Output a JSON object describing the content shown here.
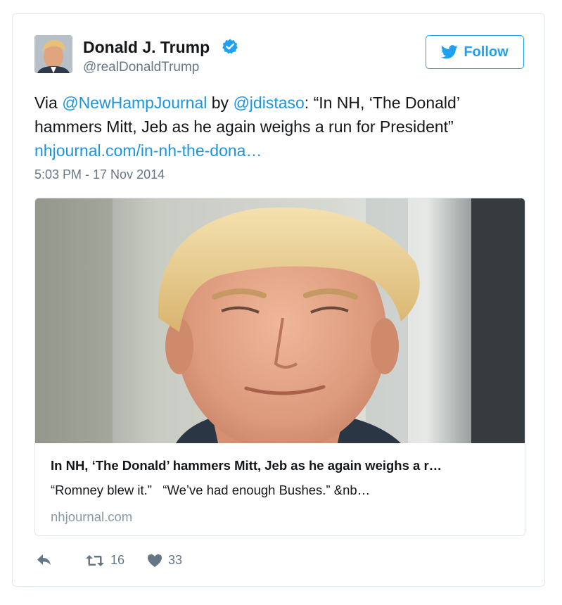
{
  "tweet": {
    "author_name": "Donald J. Trump",
    "author_handle": "@realDonaldTrump",
    "verified_icon": "verified-badge-icon",
    "follow_label": "Follow",
    "text_before_mention1": "Via ",
    "mention1": "@NewHampJournal",
    "text_between_mentions": " by ",
    "mention2": "@jdistaso",
    "text_after_mention2": ": “In NH, ‘The Donald’ hammers Mitt, Jeb as he again weighs a run for President”",
    "link": "nhjournal.com/in-nh-the-dona…",
    "timestamp": "5:03 PM - 17 Nov 2014"
  },
  "link_card": {
    "title": "In NH, ‘The Donald’ hammers Mitt, Jeb as he again weighs a r…",
    "description": "“Romney blew it.”   “We’ve had enough Bushes.” &nb…",
    "domain": "nhjournal.com"
  },
  "actions": {
    "reply_icon": "reply-icon",
    "retweet_icon": "retweet-icon",
    "retweet_count": "16",
    "like_icon": "heart-icon",
    "like_count": "33"
  },
  "colors": {
    "link": "#1b95e0",
    "follow": "#1da1f2",
    "secondary_text": "#657786",
    "border": "#e1e8ed"
  }
}
